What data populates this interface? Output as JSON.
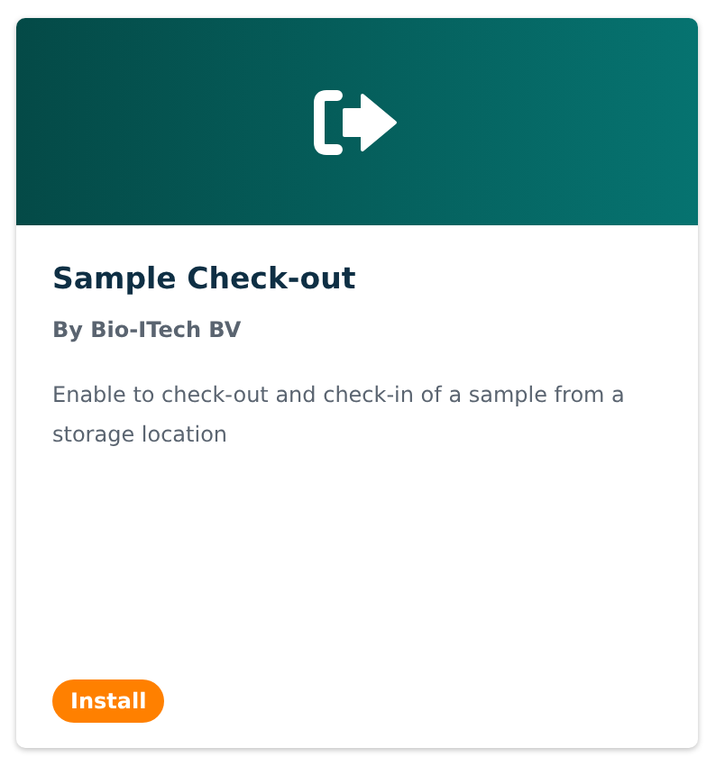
{
  "card": {
    "title": "Sample Check-out",
    "publisher": "By Bio-ITech BV",
    "description": "Enable to check-out and check-in of a sample from a storage location",
    "button": "Install"
  }
}
